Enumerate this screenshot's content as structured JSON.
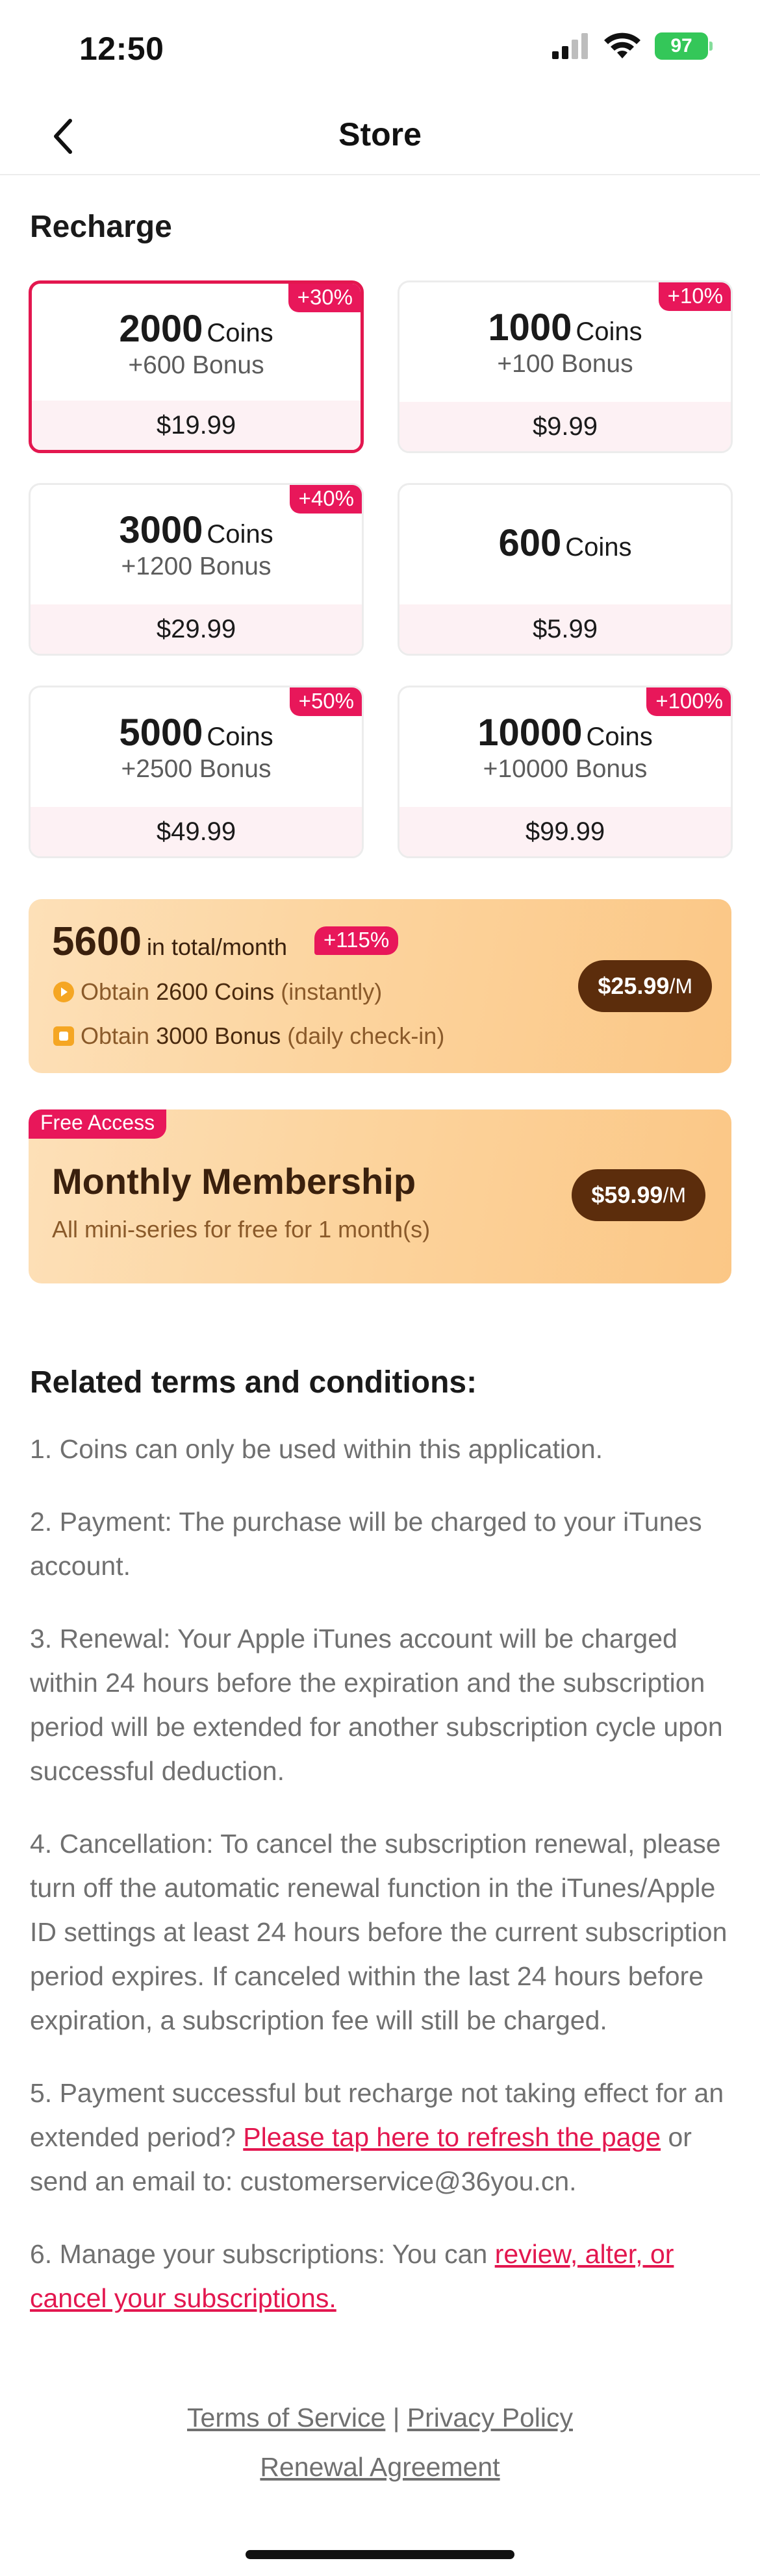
{
  "status_bar": {
    "time": "12:50",
    "battery": "97"
  },
  "nav": {
    "title": "Store"
  },
  "recharge": {
    "title": "Recharge",
    "coins_unit": "Coins",
    "cards": [
      {
        "coins": "2000",
        "bonus": "+600 Bonus",
        "price": "$19.99",
        "tag": "+30%"
      },
      {
        "coins": "1000",
        "bonus": "+100 Bonus",
        "price": "$9.99",
        "tag": "+10%"
      },
      {
        "coins": "3000",
        "bonus": "+1200 Bonus",
        "price": "$29.99",
        "tag": "+40%"
      },
      {
        "coins": "600",
        "bonus": "",
        "price": "$5.99",
        "tag": ""
      },
      {
        "coins": "5000",
        "bonus": "+2500 Bonus",
        "price": "$49.99",
        "tag": "+50%"
      },
      {
        "coins": "10000",
        "bonus": "+10000 Bonus",
        "price": "$99.99",
        "tag": "+100%"
      }
    ]
  },
  "subscription": {
    "total": "5600",
    "total_suffix": "in total/month",
    "tag": "+115%",
    "line1_prefix": "Obtain",
    "line1_strong": "2600 Coins",
    "line1_suffix": "(instantly)",
    "line2_prefix": "Obtain",
    "line2_strong": "3000 Bonus",
    "line2_suffix": "(daily check-in)",
    "price": "$25.99",
    "per": "/M"
  },
  "membership": {
    "tag": "Free Access",
    "title": "Monthly Membership",
    "desc": "All mini-series for free for 1 month(s)",
    "price": "$59.99",
    "per": "/M"
  },
  "terms": {
    "title": "Related terms and conditions:",
    "t1": "1. Coins can only be used within this application.",
    "t2": "2. Payment: The purchase will be charged to your iTunes account.",
    "t3": "3. Renewal: Your Apple iTunes account will be charged within 24 hours before the expiration and the subscription period will be extended for another subscription cycle upon successful deduction.",
    "t4": "4. Cancellation: To cancel the subscription renewal, please turn off the automatic renewal function in the iTunes/Apple ID settings at least 24 hours before the current subscription period expires. If canceled within the last 24 hours before expiration, a subscription fee will still be charged.",
    "t5_prefix": "5. Payment successful but recharge not taking effect for an extended period? ",
    "t5_link": "Please tap here to refresh the page",
    "t5_suffix": " or send an email to: customerservice@36you.cn.",
    "t6_prefix": "6. Manage your subscriptions: You can ",
    "t6_link": "review, alter, or cancel your subscriptions."
  },
  "footer": {
    "terms_of_service": "Terms of Service",
    "separator": "|",
    "privacy_policy": "Privacy Policy",
    "renewal_agreement": "Renewal Agreement"
  },
  "colors": {
    "accent": "#e3174f",
    "price_pill": "#5c2d0c",
    "battery": "#34c759"
  }
}
